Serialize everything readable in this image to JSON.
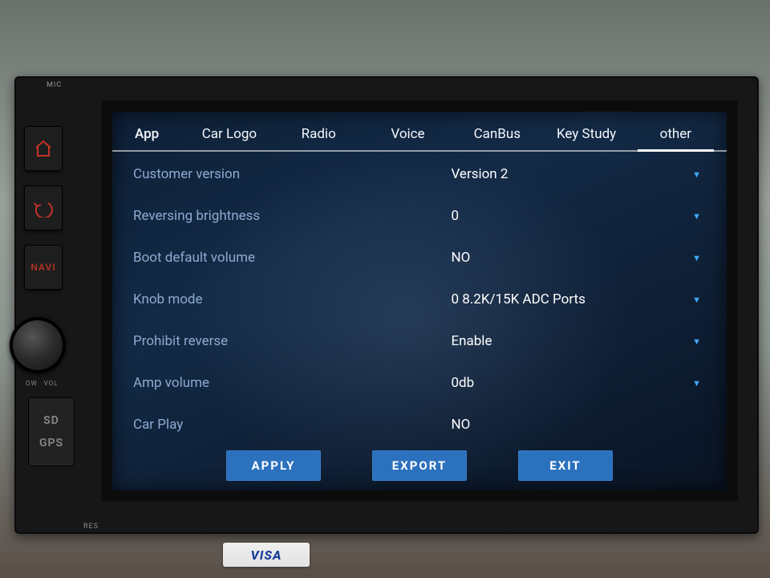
{
  "hardware": {
    "mic": "MIC",
    "res": "RES",
    "navi": "NAVI",
    "pow": "OW",
    "vol": "VOL",
    "sd": "SD",
    "gps": "GPS"
  },
  "tabs": [
    {
      "label": "App",
      "active": false
    },
    {
      "label": "Car Logo",
      "active": false
    },
    {
      "label": "Radio",
      "active": false
    },
    {
      "label": "Voice",
      "active": false
    },
    {
      "label": "CanBus",
      "active": false
    },
    {
      "label": "Key Study",
      "active": false
    },
    {
      "label": "other",
      "active": true
    }
  ],
  "settings": [
    {
      "label": "Customer version",
      "value": "Version 2"
    },
    {
      "label": "Reversing brightness",
      "value": "0"
    },
    {
      "label": "Boot default volume",
      "value": "NO"
    },
    {
      "label": "Knob mode",
      "value": "0 8.2K/15K ADC Ports"
    },
    {
      "label": "Prohibit reverse",
      "value": "Enable"
    },
    {
      "label": "Amp volume",
      "value": "0db"
    },
    {
      "label": "Car Play",
      "value": "NO"
    }
  ],
  "buttons": {
    "apply": "APPLY",
    "export": "EXPORT",
    "exit": "EXIT"
  },
  "environment": {
    "visa": "VISA"
  }
}
